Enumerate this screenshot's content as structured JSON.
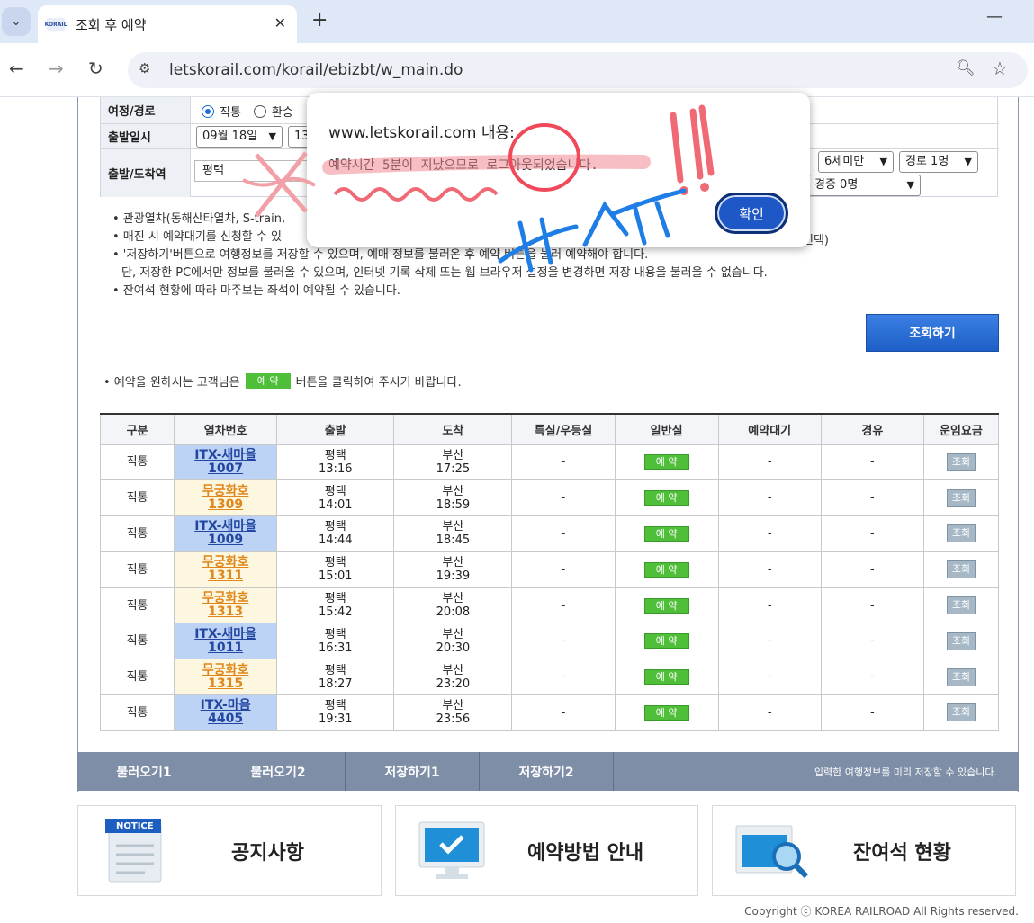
{
  "browser": {
    "tab_title": "조회 후 예약",
    "favicon_text": "KORAIL",
    "url": "letskorail.com/korail/ebizbt/w_main.do"
  },
  "form": {
    "route_label": "여정/경로",
    "route_option1": "직통",
    "route_option2": "환승",
    "date_label": "출발일시",
    "date_value": "09월 18일",
    "date_partial": "13",
    "station_label": "출발/도착역",
    "station_from": "평택",
    "child_select": "6세미만",
    "senior_select": "경로 1명",
    "disabled_select": "경증 0명"
  },
  "notes": [
    "• 관광열차(동해산타열차, S-train,",
    "• 매진 시 예약대기를 신청할 수 있",
    "• '저장하기'버튼으로 여행정보를 저장할 수 있으며, 예매 정보를 불러온 후 예약 버튼을 눌러 예약해야 합니다.",
    "  단, 저장한 PC에서만 정보를 불러올 수 있으며, 인터넷 기록 삭제 또는 웹 브라우저 설정을 변경하면 저장 내용을 불러올 수 없습니다.",
    "• 잔여석 현황에 따라 마주보는 좌석이 예약될 수 있습니다."
  ],
  "notes_tail": "선택)",
  "search_button": "조회하기",
  "reserve_hint": {
    "before": "• 예약을 원하시는 고객님은",
    "button": "예 약",
    "after": "버튼을 클릭하여 주시기 바랍니다."
  },
  "table": {
    "headers": [
      "구분",
      "열차번호",
      "출발",
      "도착",
      "특실/우등실",
      "일반실",
      "예약대기",
      "경유",
      "운임요금"
    ],
    "reserve_label": "예 약",
    "fare_label": "조회",
    "dash": "-",
    "rows": [
      {
        "type": "직통",
        "train_name": "ITX-새마을",
        "train_no": "1007",
        "kind": "itx",
        "dep_station": "평택",
        "dep_time": "13:16",
        "arr_station": "부산",
        "arr_time": "17:25"
      },
      {
        "type": "직통",
        "train_name": "무궁화호",
        "train_no": "1309",
        "kind": "mugung",
        "dep_station": "평택",
        "dep_time": "14:01",
        "arr_station": "부산",
        "arr_time": "18:59"
      },
      {
        "type": "직통",
        "train_name": "ITX-새마을",
        "train_no": "1009",
        "kind": "itx",
        "dep_station": "평택",
        "dep_time": "14:44",
        "arr_station": "부산",
        "arr_time": "18:45"
      },
      {
        "type": "직통",
        "train_name": "무궁화호",
        "train_no": "1311",
        "kind": "mugung",
        "dep_station": "평택",
        "dep_time": "15:01",
        "arr_station": "부산",
        "arr_time": "19:39"
      },
      {
        "type": "직통",
        "train_name": "무궁화호",
        "train_no": "1313",
        "kind": "mugung",
        "dep_station": "평택",
        "dep_time": "15:42",
        "arr_station": "부산",
        "arr_time": "20:08"
      },
      {
        "type": "직통",
        "train_name": "ITX-새마을",
        "train_no": "1011",
        "kind": "itx",
        "dep_station": "평택",
        "dep_time": "16:31",
        "arr_station": "부산",
        "arr_time": "20:30"
      },
      {
        "type": "직통",
        "train_name": "무궁화호",
        "train_no": "1315",
        "kind": "mugung",
        "dep_station": "평택",
        "dep_time": "18:27",
        "arr_station": "부산",
        "arr_time": "23:20"
      },
      {
        "type": "직통",
        "train_name": "ITX-마음",
        "train_no": "4405",
        "kind": "itx",
        "dep_station": "평택",
        "dep_time": "19:31",
        "arr_station": "부산",
        "arr_time": "23:56"
      }
    ]
  },
  "actionbar": {
    "load1": "불러오기1",
    "load2": "불러오기2",
    "save1": "저장하기1",
    "save2": "저장하기2",
    "note": "입력한 여행정보를 미리 저장할 수 있습니다."
  },
  "cards": {
    "notice_badge": "NOTICE",
    "notice": "공지사항",
    "guide": "예약방법 안내",
    "seats": "잔여석 현황"
  },
  "copyright": "Copyright ⓒ KOREA RAILROAD All Rights reserved.",
  "dialog": {
    "title": "www.letskorail.com 내용:",
    "message": "예약시간 5분이 지났으므로 로그아웃되었습니다.",
    "ok": "확인"
  },
  "colors": {
    "itx_cell": "#bcd3f5",
    "mugung_cell": "#fdf7e0",
    "reserve_green": "#4fbf3a",
    "primary_blue": "#1e57c6"
  }
}
